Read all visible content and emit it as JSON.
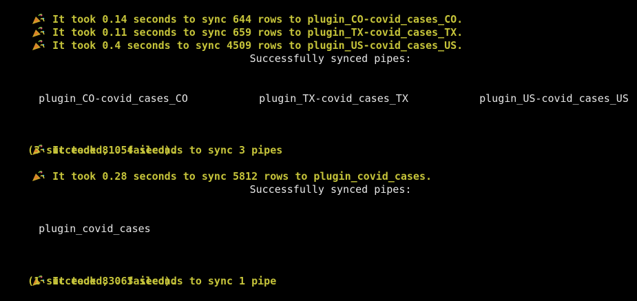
{
  "colors": {
    "background": "#000000",
    "message": "#c6c43a",
    "plain_text": "#e6e6e6"
  },
  "icon": "party-popper-icon",
  "block1": {
    "line1": "It took 0.14 seconds to sync 644 rows to plugin_CO-covid_cases_CO.",
    "line2": "It took 0.11 seconds to sync 659 rows to plugin_TX-covid_cases_TX.",
    "line3": "It took 0.4 seconds to sync 4509 rows to plugin_US-covid_cases_US.",
    "heading": "Successfully synced pipes:",
    "pipes": [
      "plugin_CO-covid_cases_CO",
      "plugin_TX-covid_cases_TX",
      "plugin_US-covid_cases_US"
    ],
    "summary": "It took 81.54 seconds to sync 3 pipes",
    "summary_detail": "(3 succeeded, 0 failed)."
  },
  "block2": {
    "line1": "It took 0.28 seconds to sync 5812 rows to plugin_covid_cases.",
    "heading": "Successfully synced pipes:",
    "pipes": [
      "plugin_covid_cases"
    ],
    "summary": "It took 83.63 seconds to sync 1 pipe",
    "summary_detail": "(1 succeeded, 0 failed)."
  }
}
